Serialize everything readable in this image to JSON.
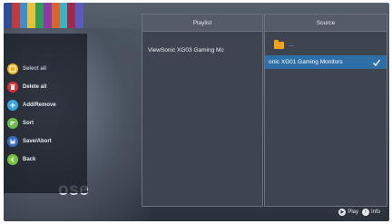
{
  "menu": {
    "items": [
      {
        "label": "Select all",
        "icon": "select-all-icon",
        "color": "#e7b322"
      },
      {
        "label": "Delete all",
        "icon": "trash-icon",
        "color": "#d8333a"
      },
      {
        "label": "Add/Remove",
        "icon": "add-remove-icon",
        "color": "#3aa5df"
      },
      {
        "label": "Sort",
        "icon": "sort-icon",
        "color": "#6dbb4a"
      },
      {
        "label": "Save/Abort",
        "icon": "save-icon",
        "color": "#3b6fc4"
      },
      {
        "label": "Back",
        "icon": "back-icon",
        "color": "#7cc242"
      }
    ]
  },
  "background_word": "ose",
  "playlist": {
    "title": "Playlist",
    "items": [
      "ViewSonic XG03 Gaming Mc"
    ]
  },
  "source": {
    "title": "Source",
    "folder_label": "...",
    "items": [
      {
        "label": "onic XG01 Gaming Monitors",
        "selected": true
      }
    ]
  },
  "hints": {
    "play": "Play",
    "info": "Info"
  },
  "colors": {
    "selection": "#2f6fa8",
    "folder": "#f5a31a"
  }
}
